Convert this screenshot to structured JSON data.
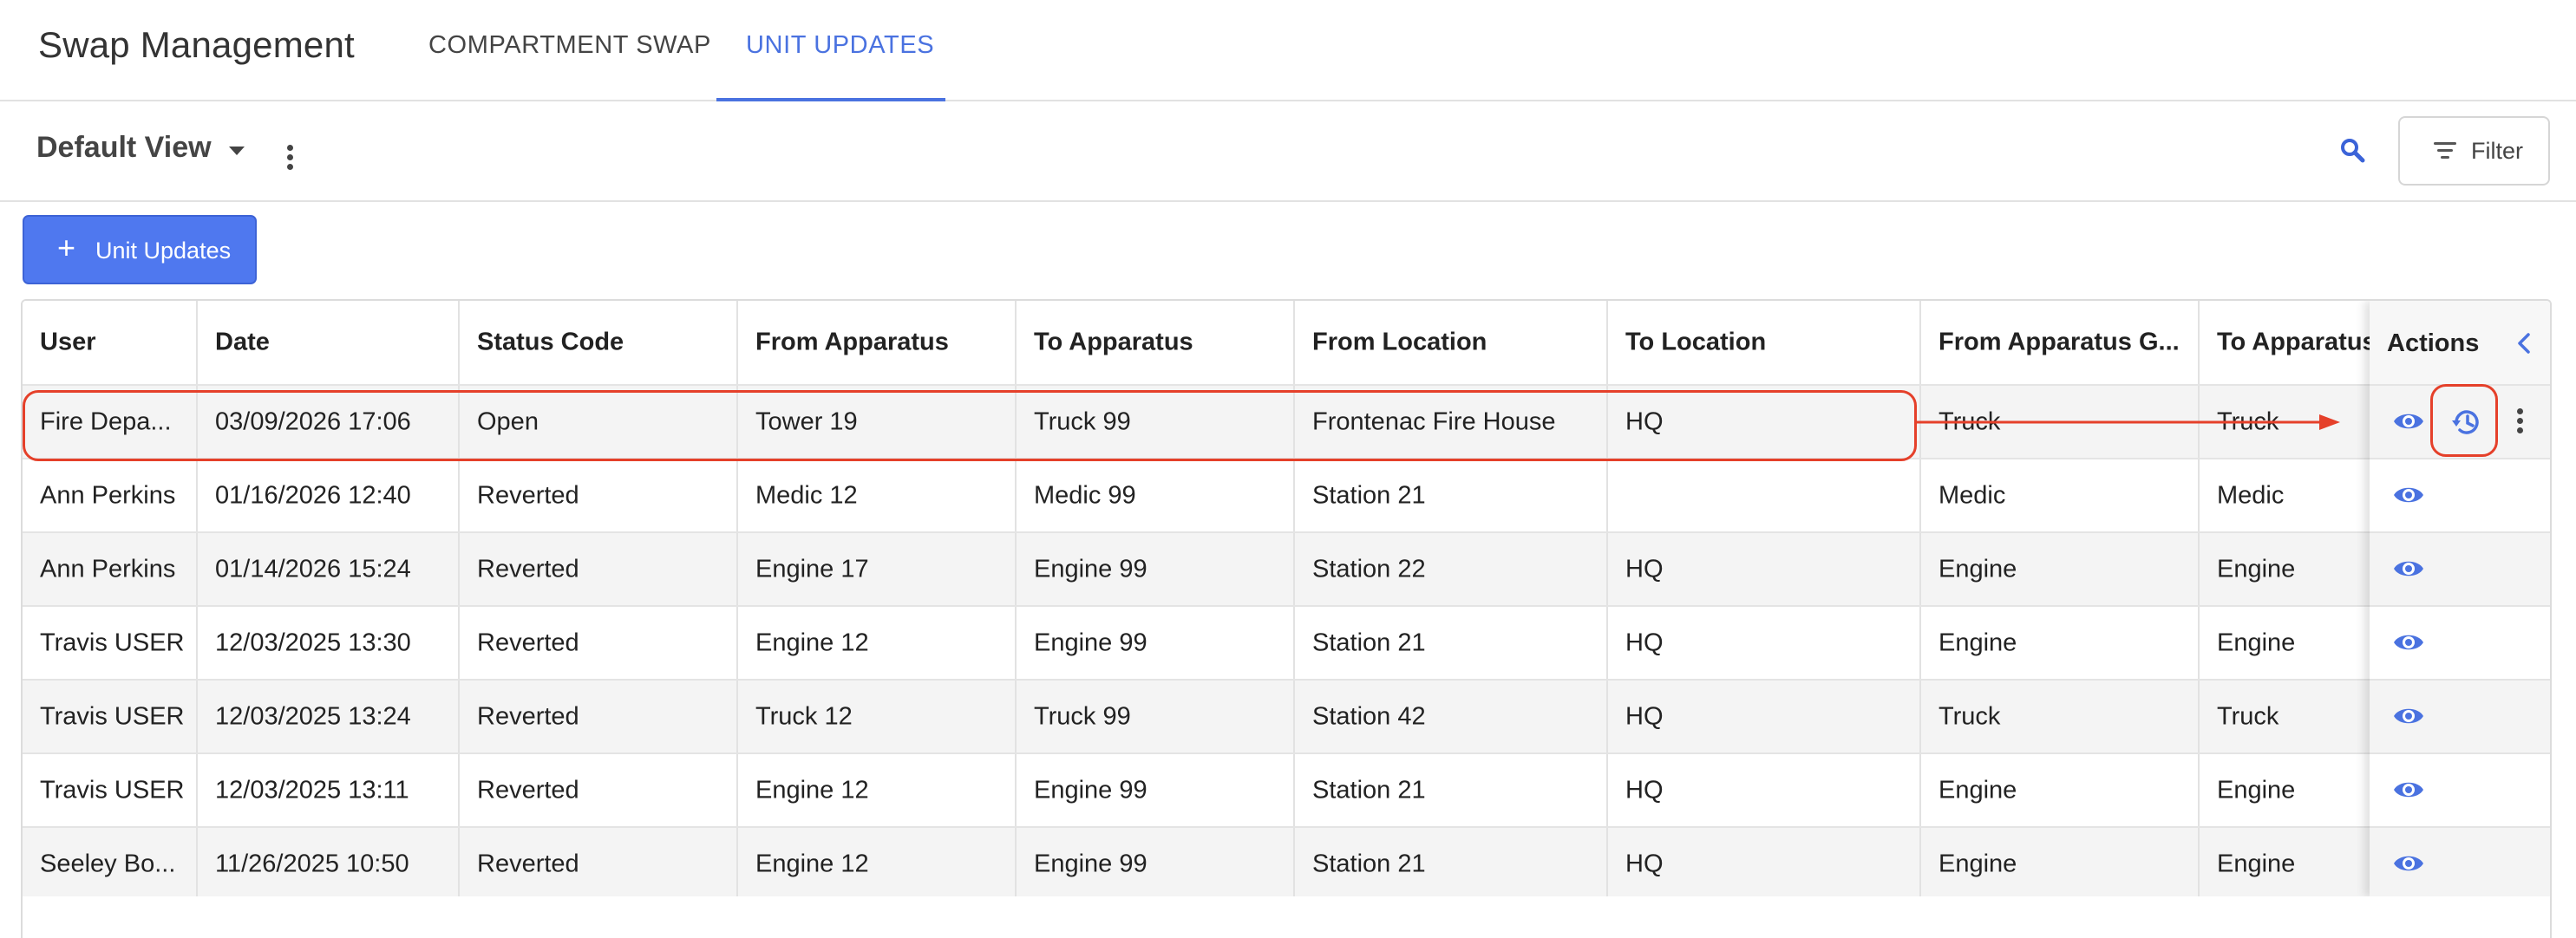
{
  "app": {
    "title": "Swap Management",
    "tabs": [
      {
        "label": "COMPARTMENT SWAP",
        "active": false
      },
      {
        "label": "UNIT UPDATES",
        "active": true
      }
    ]
  },
  "view": {
    "name": "Default View",
    "filter_label": "Filter"
  },
  "add_button": {
    "plus": "+",
    "label": "Unit Updates"
  },
  "table": {
    "columns": [
      "User",
      "Date",
      "Status Code",
      "From Apparatus",
      "To Apparatus",
      "From Location",
      "To Location",
      "From Apparatus G...",
      "To Apparatus"
    ],
    "actions_header": "Actions",
    "rows": [
      [
        "Fire Depa...",
        "03/09/2026 17:06",
        "Open",
        "Tower 19",
        "Truck 99",
        "Frontenac Fire House",
        "HQ",
        "Truck",
        "Truck"
      ],
      [
        "Ann Perkins",
        "01/16/2026 12:40",
        "Reverted",
        "Medic 12",
        "Medic 99",
        "Station 21",
        "",
        "Medic",
        "Medic"
      ],
      [
        "Ann Perkins",
        "01/14/2026 15:24",
        "Reverted",
        "Engine 17",
        "Engine 99",
        "Station 22",
        "HQ",
        "Engine",
        "Engine"
      ],
      [
        "Travis USER",
        "12/03/2025 13:30",
        "Reverted",
        "Engine 12",
        "Engine 99",
        "Station 21",
        "HQ",
        "Engine",
        "Engine"
      ],
      [
        "Travis USER",
        "12/03/2025 13:24",
        "Reverted",
        "Truck 12",
        "Truck 99",
        "Station 42",
        "HQ",
        "Truck",
        "Truck"
      ],
      [
        "Travis USER",
        "12/03/2025 13:11",
        "Reverted",
        "Engine 12",
        "Engine 99",
        "Station 21",
        "HQ",
        "Engine",
        "Engine"
      ],
      [
        "Seeley Bo...",
        "11/26/2025 10:50",
        "Reverted",
        "Engine 12",
        "Engine 99",
        "Station 21",
        "HQ",
        "Engine",
        "Engine"
      ]
    ]
  },
  "icons": {
    "view_dropdown": "caret-down-icon",
    "view_menu": "more-vertical-icon",
    "search": "search-icon",
    "filter": "filter-lines-icon",
    "collapse": "chevron-left-icon",
    "view_row": "eye-icon",
    "revert_row": "history-icon",
    "row_menu": "more-vertical-icon"
  },
  "colors": {
    "accent": "#4a72e0",
    "button": "#4f78ef",
    "annotation": "#e5402a",
    "row_alt": "#f4f4f4"
  }
}
